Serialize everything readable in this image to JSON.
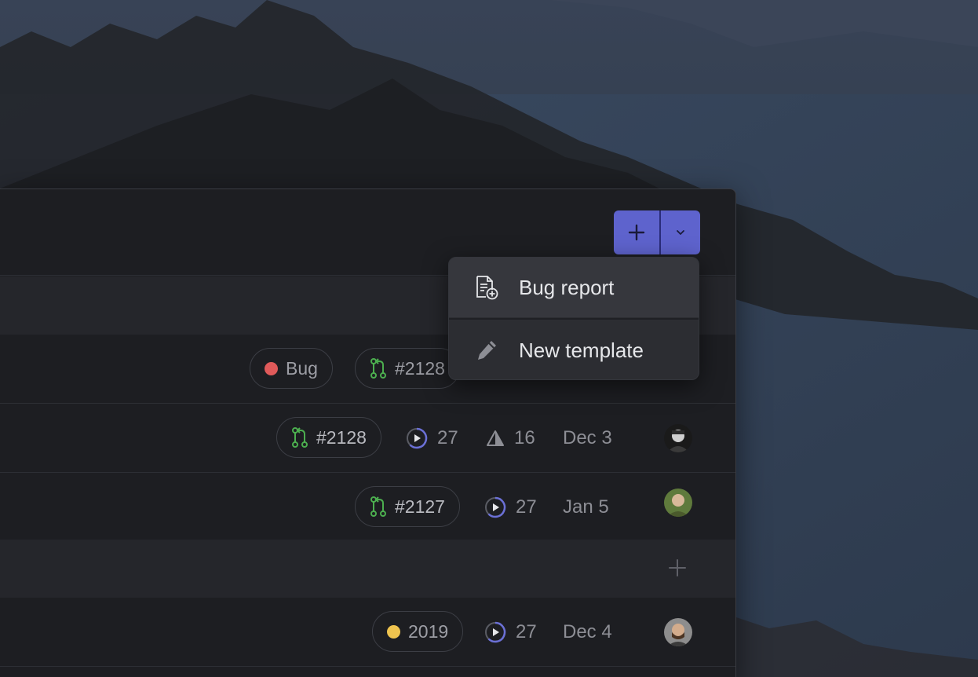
{
  "toolbar": {
    "new_issue_button_icon": "plus-icon",
    "menu_toggle_icon": "chevron-down-icon",
    "accent_color": "#5e63cd"
  },
  "dropdown": {
    "items": [
      {
        "label": "Bug report",
        "icon": "document-add-icon"
      },
      {
        "label": "New template",
        "icon": "pencil-icon"
      }
    ]
  },
  "rows": [
    {
      "label_tag": {
        "text": "Bug",
        "color": "#e05a5a"
      },
      "pr": "#2128"
    },
    {
      "pr": "#2128",
      "cycle": "27",
      "estimate": "16",
      "date": "Dec 3",
      "avatar": "user-avatar"
    },
    {
      "pr": "#2127",
      "cycle": "27",
      "date": "Jan 5",
      "avatar": "user-avatar"
    },
    {
      "label_tag": {
        "text": "2019",
        "color": "#efc44f"
      },
      "cycle": "27",
      "date": "Dec 4",
      "avatar": "user-avatar"
    }
  ],
  "group2": {
    "add_icon": "plus-icon"
  },
  "colors": {
    "pr_icon": "#4cae4f",
    "cycle_icon": "#6b70d6"
  }
}
